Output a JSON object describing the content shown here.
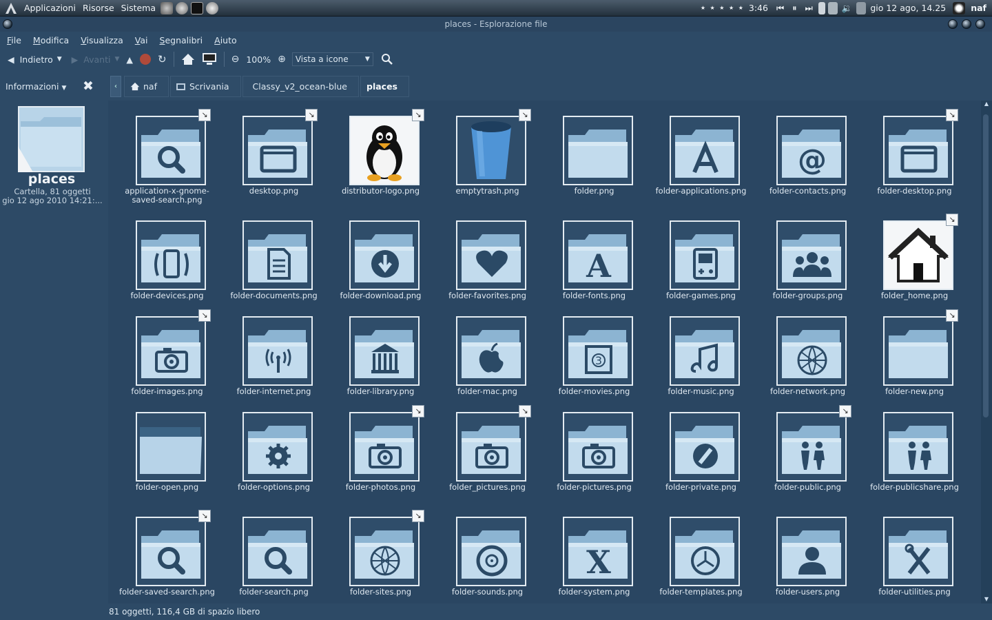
{
  "panel": {
    "menus": [
      "Applicazioni",
      "Risorse",
      "Sistema"
    ],
    "stars": "★ ★ ★ ★ ★",
    "time_played": "3:46",
    "clock": "gio 12 ago, 14.25",
    "user": "naf"
  },
  "window": {
    "title": "places - Esplorazione file"
  },
  "menubar": [
    "File",
    "Modifica",
    "Visualizza",
    "Vai",
    "Segnalibri",
    "Aiuto"
  ],
  "toolbar": {
    "back": "Indietro",
    "forward": "Avanti",
    "zoom": "100%",
    "view": "Vista a icone"
  },
  "side": {
    "header": "Informazioni",
    "name": "places",
    "info1": "Cartella, 81 oggetti",
    "info2": "gio 12 ago 2010 14:21:..."
  },
  "path": [
    "naf",
    "Scrivania",
    "Classy_v2_ocean-blue",
    "places"
  ],
  "items": [
    {
      "label": "application-x-gnome-saved-search.png",
      "glyph": "search",
      "link": true
    },
    {
      "label": "desktop.png",
      "glyph": "window",
      "link": true
    },
    {
      "label": "distributor-logo.png",
      "glyph": "tux",
      "link": true
    },
    {
      "label": "emptytrash.png",
      "glyph": "trash",
      "link": true
    },
    {
      "label": "folder.png",
      "glyph": "plain",
      "link": false
    },
    {
      "label": "folder-applications.png",
      "glyph": "apps",
      "link": false
    },
    {
      "label": "folder-contacts.png",
      "glyph": "at",
      "link": false
    },
    {
      "label": "folder-desktop.png",
      "glyph": "window",
      "link": true
    },
    {
      "label": "folder-devices.png",
      "glyph": "phone",
      "link": false
    },
    {
      "label": "folder-documents.png",
      "glyph": "doc",
      "link": false
    },
    {
      "label": "folder-download.png",
      "glyph": "download",
      "link": false
    },
    {
      "label": "folder-favorites.png",
      "glyph": "heart",
      "link": false
    },
    {
      "label": "folder-fonts.png",
      "glyph": "A",
      "link": false
    },
    {
      "label": "folder-games.png",
      "glyph": "game",
      "link": false
    },
    {
      "label": "folder-groups.png",
      "glyph": "group",
      "link": false
    },
    {
      "label": "folder_home.png",
      "glyph": "home",
      "link": true
    },
    {
      "label": "folder-images.png",
      "glyph": "camera",
      "link": true
    },
    {
      "label": "folder-internet.png",
      "glyph": "antenna",
      "link": false
    },
    {
      "label": "folder-library.png",
      "glyph": "library",
      "link": false
    },
    {
      "label": "folder-mac.png",
      "glyph": "apple",
      "link": false
    },
    {
      "label": "folder-movies.png",
      "glyph": "film",
      "link": false
    },
    {
      "label": "folder-music.png",
      "glyph": "music",
      "link": false
    },
    {
      "label": "folder-network.png",
      "glyph": "globe",
      "link": false
    },
    {
      "label": "folder-new.png",
      "glyph": "plain",
      "link": true
    },
    {
      "label": "folder-open.png",
      "glyph": "open",
      "link": false
    },
    {
      "label": "folder-options.png",
      "glyph": "gear",
      "link": false
    },
    {
      "label": "folder-photos.png",
      "glyph": "camera",
      "link": true
    },
    {
      "label": "folder_pictures.png",
      "glyph": "camera",
      "link": true
    },
    {
      "label": "folder-pictures.png",
      "glyph": "camera",
      "link": false
    },
    {
      "label": "folder-private.png",
      "glyph": "block",
      "link": false
    },
    {
      "label": "folder-public.png",
      "glyph": "people",
      "link": true
    },
    {
      "label": "folder-publicshare.png",
      "glyph": "people",
      "link": false
    },
    {
      "label": "folder-saved-search.png",
      "glyph": "search",
      "link": true
    },
    {
      "label": "folder-search.png",
      "glyph": "search",
      "link": false
    },
    {
      "label": "folder-sites.png",
      "glyph": "globe",
      "link": true
    },
    {
      "label": "folder-sounds.png",
      "glyph": "disc",
      "link": false
    },
    {
      "label": "folder-system.png",
      "glyph": "X",
      "link": false
    },
    {
      "label": "folder-templates.png",
      "glyph": "clock",
      "link": false
    },
    {
      "label": "folder-users.png",
      "glyph": "user",
      "link": false
    },
    {
      "label": "folder-utilities.png",
      "glyph": "tools",
      "link": false
    }
  ],
  "status": "81 oggetti, 116,4 GB di spazio libero"
}
